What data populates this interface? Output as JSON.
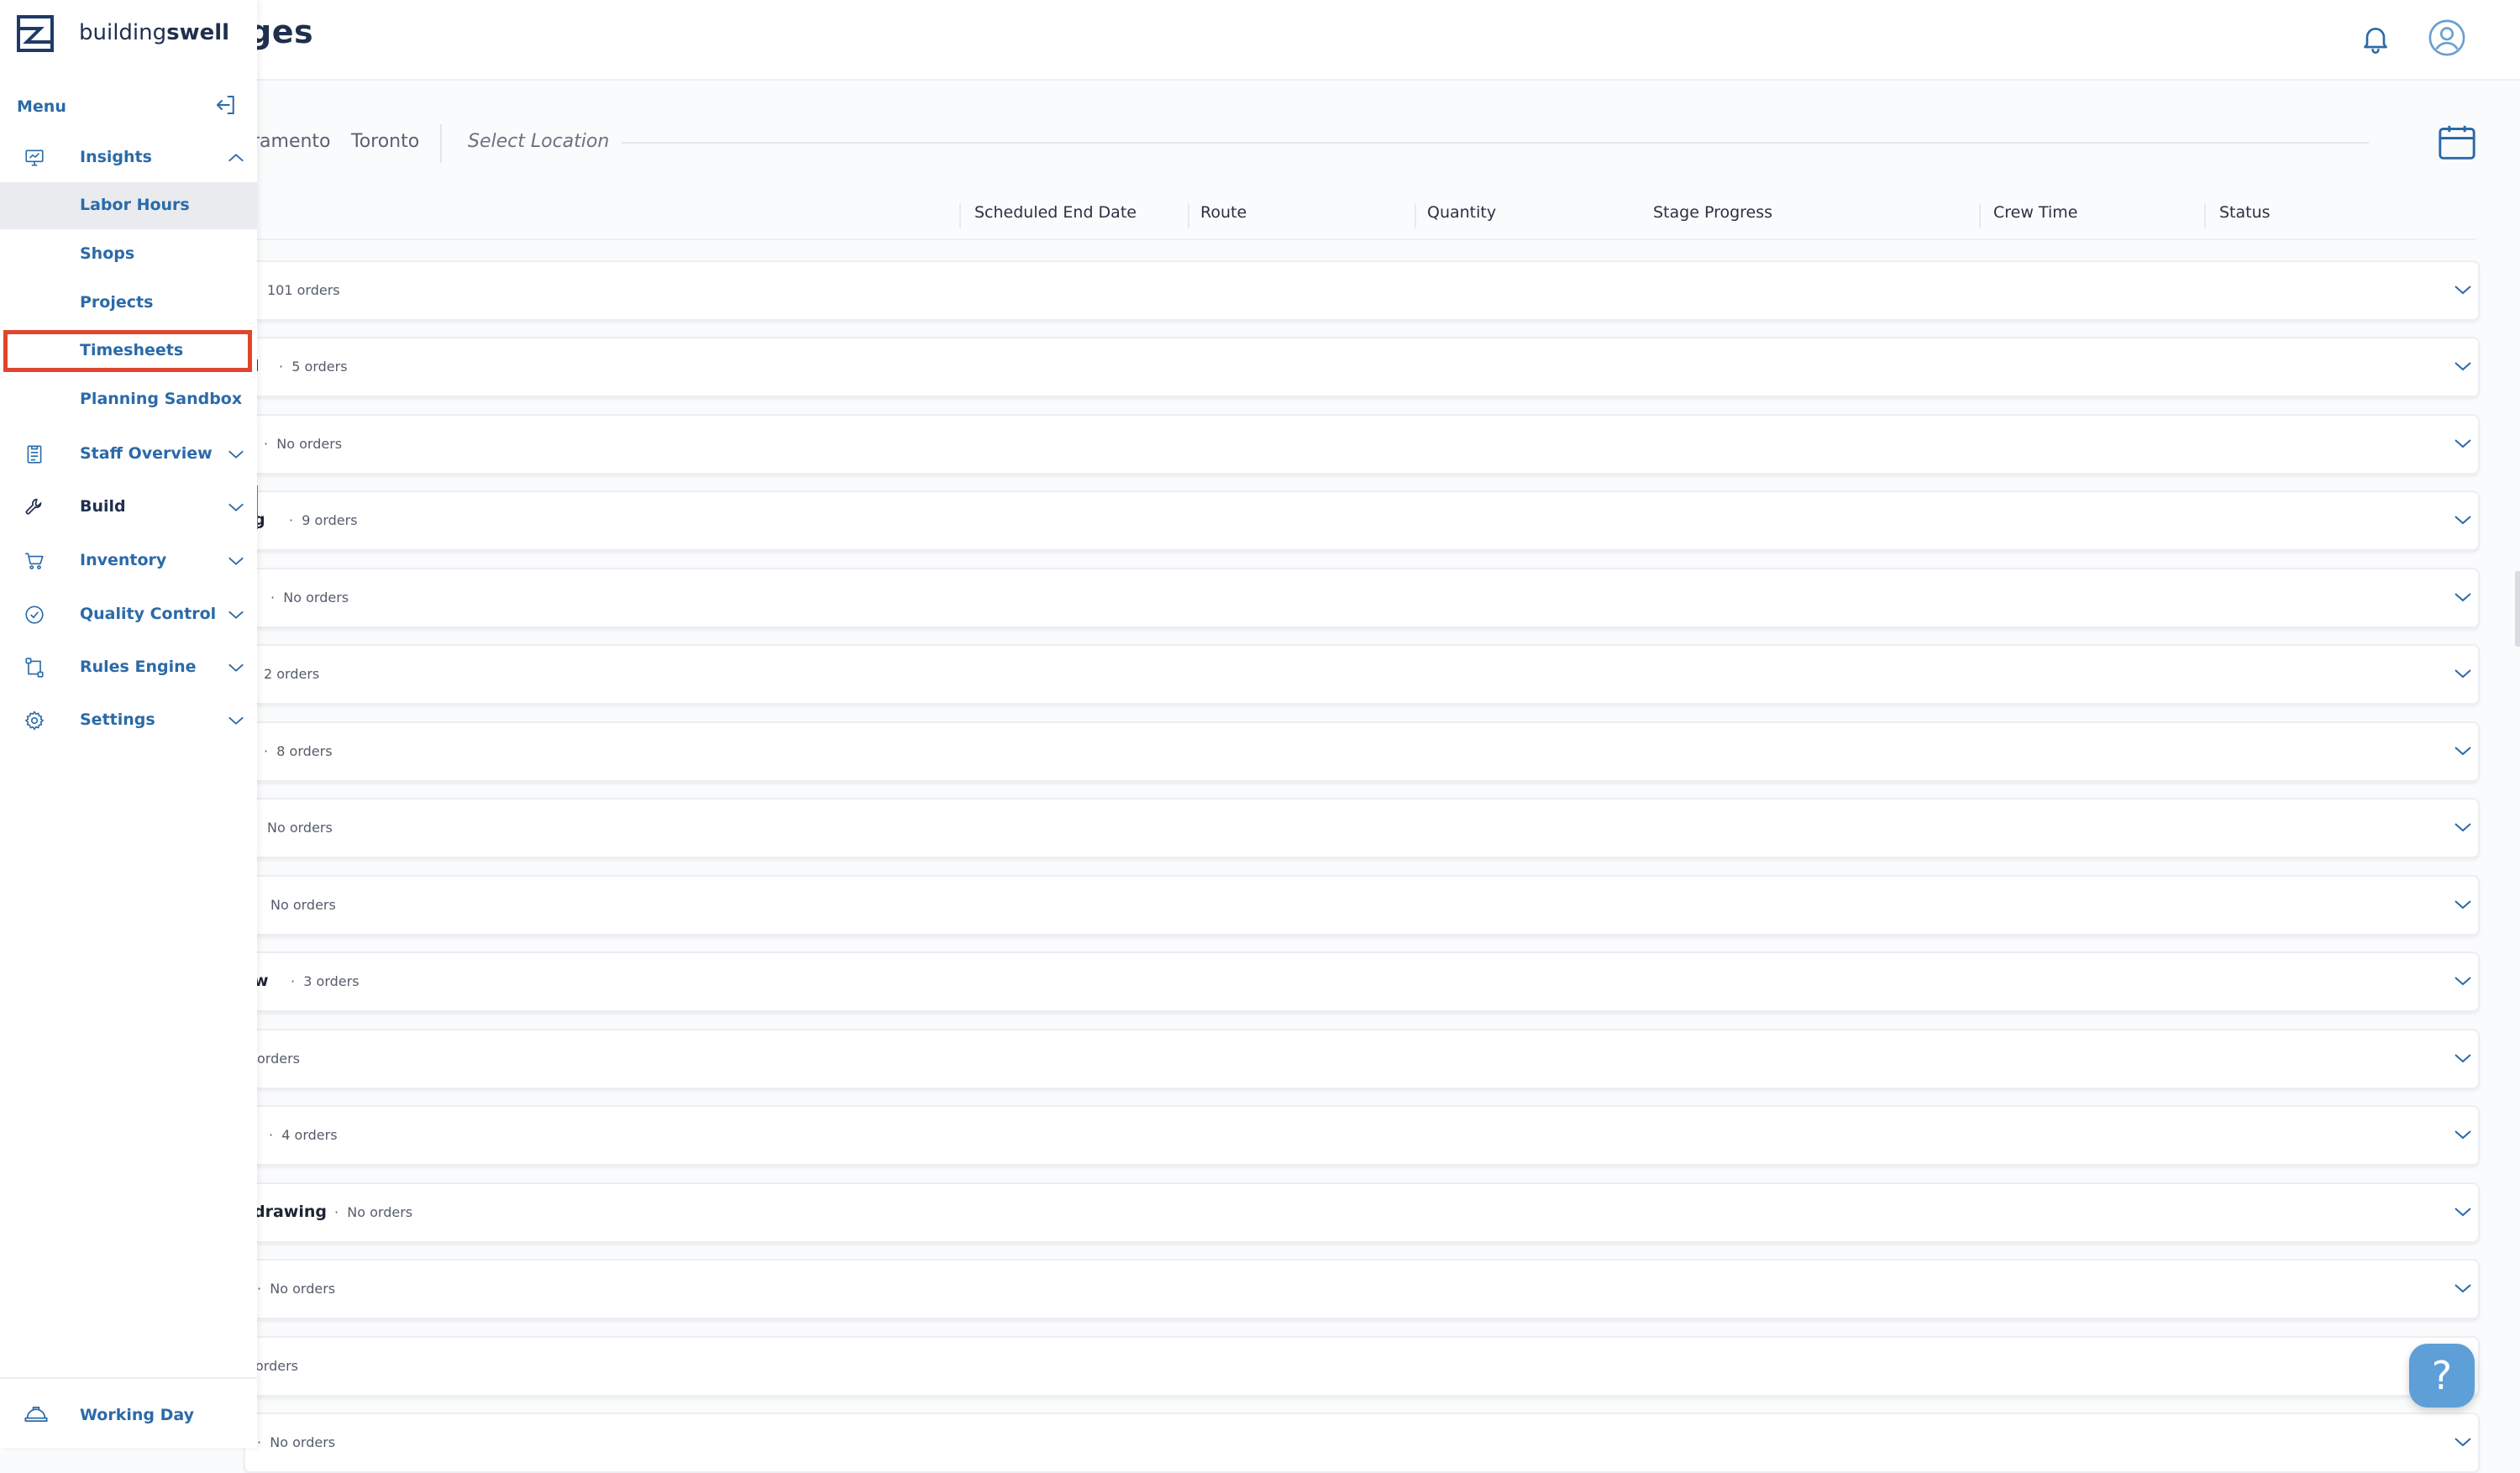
{
  "app": {
    "logo_text_regular": "building",
    "logo_text_bold": "swell"
  },
  "header": {
    "page_title": "ges"
  },
  "filters": {
    "locations": [
      "ramento",
      "Toronto"
    ],
    "select_location": "Select Location"
  },
  "columns": [
    "Scheduled End Date",
    "Route",
    "Quantity",
    "Stage Progress",
    "Crew Time",
    "Status"
  ],
  "rows": [
    {
      "name": "",
      "count": "101 orders"
    },
    {
      "name": "l",
      "count": "5 orders"
    },
    {
      "name": "",
      "count": "No orders"
    },
    {
      "name": "g",
      "count": "9 orders"
    },
    {
      "name": "",
      "count": "No orders"
    },
    {
      "name": "",
      "count": "2 orders"
    },
    {
      "name": "",
      "count": "8 orders"
    },
    {
      "name": "",
      "count": "No orders"
    },
    {
      "name": "",
      "count": "No orders"
    },
    {
      "name": "w",
      "count": "3 orders"
    },
    {
      "name": "",
      "count": "orders"
    },
    {
      "name": "",
      "count": "4 orders"
    },
    {
      "name": "drawing",
      "count": "No orders"
    },
    {
      "name": "",
      "count": "No orders"
    },
    {
      "name": "",
      "count": "orders"
    },
    {
      "name": "",
      "count": "No orders"
    }
  ],
  "sidebar": {
    "menu_label": "Menu",
    "items": [
      {
        "label": "Insights",
        "icon": "monitor-icon"
      },
      {
        "label": "Staff Overview",
        "icon": "clipboard-icon"
      },
      {
        "label": "Build",
        "icon": "wrench-icon"
      },
      {
        "label": "Inventory",
        "icon": "cart-icon"
      },
      {
        "label": "Quality Control",
        "icon": "check-circle-icon"
      },
      {
        "label": "Rules Engine",
        "icon": "route-icon"
      },
      {
        "label": "Settings",
        "icon": "gear-icon"
      }
    ],
    "insights_sub": [
      "Labor Hours",
      "Shops",
      "Projects",
      "Timesheets",
      "Planning Sandbox"
    ],
    "working_day": "Working Day"
  },
  "help": {
    "label": "?"
  },
  "colors": {
    "accent": "#2b6aa8",
    "highlight": "#e0452d",
    "help_bg": "#5d9fd6"
  }
}
